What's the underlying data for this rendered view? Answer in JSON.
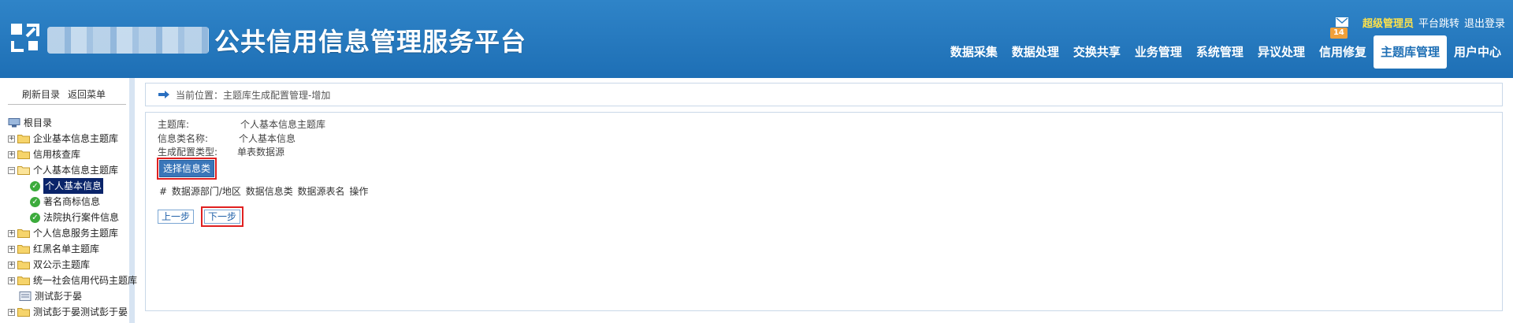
{
  "header": {
    "app_title": "公共信用信息管理服务平台",
    "mail_count": "14",
    "user_role": "超级管理员",
    "platform_switch": "平台跳转",
    "logout": "退出登录",
    "nav": [
      {
        "label": "数据采集"
      },
      {
        "label": "数据处理"
      },
      {
        "label": "交换共享"
      },
      {
        "label": "业务管理"
      },
      {
        "label": "系统管理"
      },
      {
        "label": "异议处理"
      },
      {
        "label": "信用修复"
      },
      {
        "label": "主题库管理",
        "active": true
      },
      {
        "label": "用户中心"
      }
    ]
  },
  "sidebar": {
    "refresh": "刷新目录",
    "back_menu": "返回菜单",
    "tree": {
      "root": "根目录",
      "items": [
        {
          "label": "企业基本信息主题库"
        },
        {
          "label": "信用核查库"
        },
        {
          "label": "个人基本信息主题库"
        },
        {
          "label": "个人基本信息"
        },
        {
          "label": "著名商标信息"
        },
        {
          "label": "法院执行案件信息"
        },
        {
          "label": "个人信息服务主题库"
        },
        {
          "label": "红黑名单主题库"
        },
        {
          "label": "双公示主题库"
        },
        {
          "label": "统一社会信用代码主题库"
        },
        {
          "label": "测试彭于晏"
        },
        {
          "label": "测试彭于晏测试彭于晏"
        }
      ]
    }
  },
  "main": {
    "breadcrumb": "当前位置：主题库生成配置管理-增加",
    "fields": {
      "theme_label": "主题库:",
      "theme_value": "个人基本信息主题库",
      "info_class_label": "信息类名称:",
      "info_class_value": "个人基本信息",
      "config_type_label": "生成配置类型:",
      "config_type_value": "单表数据源"
    },
    "select_button": "选择信息类",
    "table_header": "# 数据源部门/地区 数据信息类 数据源表名 操作",
    "prev_button": "上一步",
    "next_button": "下一步"
  },
  "colors": {
    "header_bg": "#2378be",
    "accent_yellow": "#ffe24a",
    "highlight_red": "#e02020",
    "select_blue": "#3a76b9"
  }
}
